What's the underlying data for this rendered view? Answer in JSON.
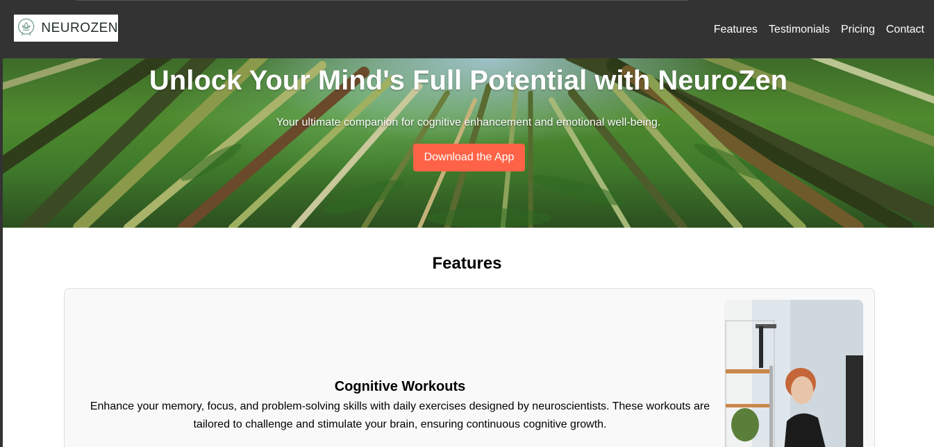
{
  "header": {
    "logo_text": "NEUROZEN",
    "nav": [
      {
        "label": "Features"
      },
      {
        "label": "Testimonials"
      },
      {
        "label": "Pricing"
      },
      {
        "label": "Contact"
      }
    ]
  },
  "hero": {
    "title": "Unlock Your Mind's Full Potential with NeuroZen",
    "subtitle": "Your ultimate companion for cognitive enhancement and emotional well-being.",
    "cta_label": "Download the App"
  },
  "features": {
    "title": "Features",
    "items": [
      {
        "title": "Cognitive Workouts",
        "description": "Enhance your memory, focus, and problem-solving skills with daily exercises designed by neuroscientists. These workouts are tailored to challenge and stimulate your brain, ensuring continuous cognitive growth."
      }
    ]
  },
  "colors": {
    "header_bg": "#333333",
    "accent": "#ff6347",
    "card_bg": "#f9f9f9"
  }
}
